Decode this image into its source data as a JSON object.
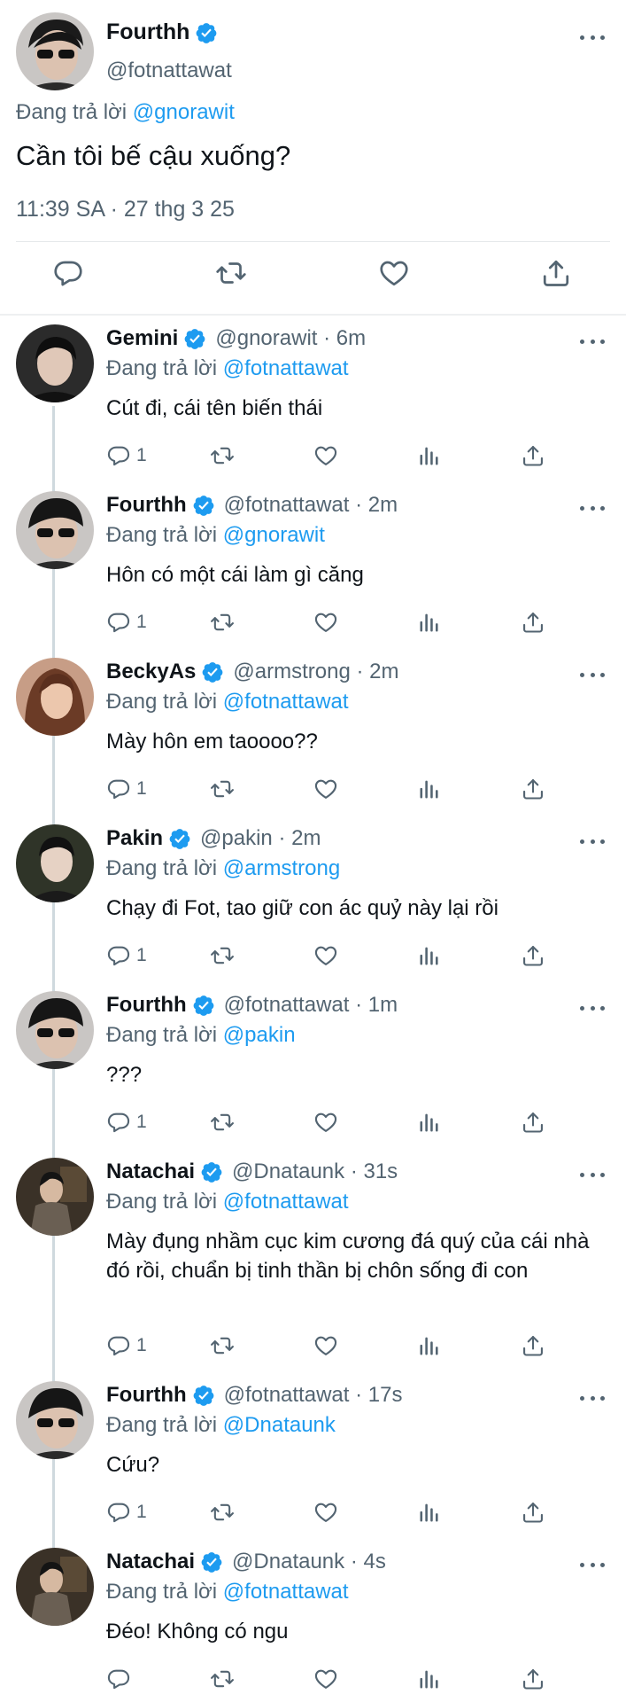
{
  "main_tweet": {
    "name": "Fourthh",
    "handle": "@fotnattawat",
    "replying_prefix": "Đang trả lời",
    "replying_to": "@gnorawit",
    "text": "Cần tôi bế cậu xuống?",
    "meta": "11:39 SA · 27 thg 3 25"
  },
  "replies": [
    {
      "name": "Gemini",
      "handle_time": "@gnorawit · 6m",
      "replying_prefix": "Đang trả lời",
      "replying_to": "@fotnattawat",
      "text": "Cút đi, cái tên biến thái",
      "reply_count": "1"
    },
    {
      "name": "Fourthh",
      "handle_time": "@fotnattawat · 2m",
      "replying_prefix": "Đang trả lời",
      "replying_to": "@gnorawit",
      "text": "Hôn có một cái làm gì căng",
      "reply_count": "1"
    },
    {
      "name": "BeckyAs",
      "handle_time": "@armstrong · 2m",
      "replying_prefix": "Đang trả lời",
      "replying_to": "@fotnattawat",
      "text": "Mày hôn em taoooo??",
      "reply_count": "1"
    },
    {
      "name": "Pakin",
      "handle_time": "@pakin · 2m",
      "replying_prefix": "Đang trả lời",
      "replying_to": "@armstrong",
      "text": "Chạy đi Fot, tao giữ con ác quỷ này lại rồi",
      "reply_count": "1"
    },
    {
      "name": "Fourthh",
      "handle_time": "@fotnattawat · 1m",
      "replying_prefix": "Đang trả lời",
      "replying_to": "@pakin",
      "text": "???",
      "reply_count": "1"
    },
    {
      "name": "Natachai",
      "handle_time": "@Dnataunk · 31s",
      "replying_prefix": "Đang trả lời",
      "replying_to": "@fotnattawat",
      "text": "Mày đụng nhầm cục kim cương đá quý của cái nhà đó rồi, chuẩn bị tinh thần bị chôn sống đi con",
      "reply_count": "1"
    },
    {
      "name": "Fourthh",
      "handle_time": "@fotnattawat · 17s",
      "replying_prefix": "Đang trả lời",
      "replying_to": "@Dnataunk",
      "text": "Cứu?",
      "reply_count": "1"
    },
    {
      "name": "Natachai",
      "handle_time": "@Dnataunk · 4s",
      "replying_prefix": "Đang trả lời",
      "replying_to": "@fotnattawat",
      "text": "Đéo! Không có ngu",
      "reply_count": ""
    }
  ],
  "colors": {
    "accent": "#1d9bf0",
    "secondary_text": "#536471",
    "text": "#0f1419",
    "divider": "#e6e9eb"
  },
  "icons": [
    "verified-badge-icon",
    "more-icon",
    "reply-icon",
    "retweet-icon",
    "like-icon",
    "views-icon",
    "share-icon"
  ]
}
